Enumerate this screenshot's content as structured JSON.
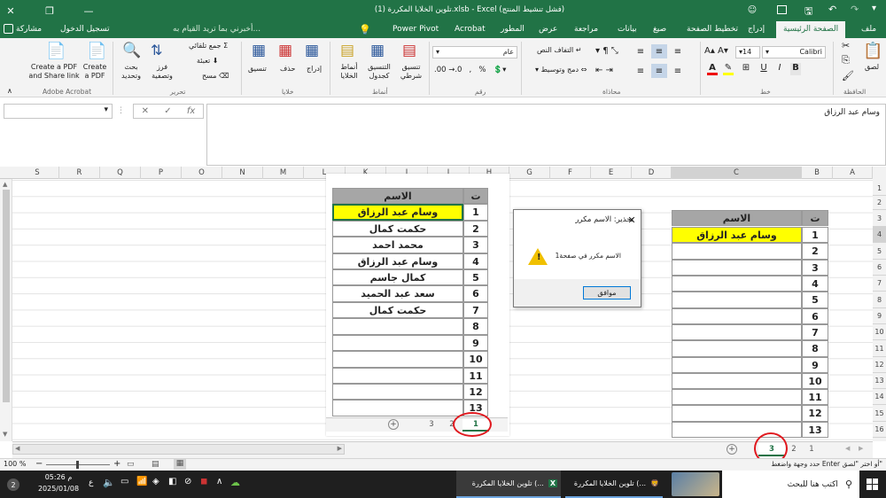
{
  "title_bar": {
    "title": "تلوين الخلايا المكررة (1).xlsb  -  Excel (فشل تنشيط المنتج)",
    "sign_in": "تسجيل الدخول",
    "share": "مشاركة"
  },
  "ribbon_tabs": {
    "file": "ملف",
    "home": "الصفحة الرئيسية",
    "insert": "إدراج",
    "page_layout": "تخطيط الصفحة",
    "formulas": "صيغ",
    "data": "بيانات",
    "review": "مراجعة",
    "view": "عرض",
    "developer": "المطور",
    "acrobat": "Acrobat",
    "power_pivot": "Power Pivot",
    "tell_me": "أخبرني بما تريد القيام به..."
  },
  "ribbon": {
    "paste": "لصق",
    "clipboard": "الحافظة",
    "font_name": "Calibri",
    "font_size": "14",
    "font_group": "خط",
    "wrap_text": "التفاف النص",
    "merge_center": "دمج وتوسيط",
    "alignment_group": "محاذاة",
    "number_format": "عام",
    "number_group": "رقم",
    "conditional_formatting": "تنسيق شرطي",
    "format_as_table": "التنسيق كجدول",
    "cell_styles": "أنماط الخلايا",
    "styles_group": "أنماط",
    "insert_cells": "إدراج",
    "delete_cells": "حذف",
    "format_cells": "تنسيق",
    "cells_group": "خلايا",
    "autosum": "جمع تلقائي",
    "fill": "تعبئة",
    "clear": "مسح",
    "sort_filter": "فرز وتصفية",
    "find_select": "بحث وتحديد",
    "editing_group": "تحرير",
    "create_pdf": "Create a PDF",
    "create_share": "Create a PDF and Share link",
    "acrobat_group": "Adobe Acrobat"
  },
  "formula_bar": {
    "content": "وسام عبد الرزاق",
    "fx": "fx"
  },
  "columns_right": [
    "A",
    "B",
    "C",
    "D",
    "E",
    "F",
    "G",
    "H",
    "I",
    "J",
    "K",
    "L",
    "M",
    "N",
    "O",
    "P",
    "Q",
    "R",
    "S"
  ],
  "rows": [
    "1",
    "2",
    "3",
    "4",
    "5",
    "6",
    "7",
    "8",
    "9",
    "10",
    "11",
    "12",
    "13",
    "14",
    "15",
    "16"
  ],
  "left_table": {
    "header_num": "ت",
    "header_name": "الاسم",
    "rows": [
      {
        "n": "1",
        "name": "وسام عبد الرزاق",
        "highlight": true
      },
      {
        "n": "2",
        "name": "حكمت كمال",
        "highlight": false
      },
      {
        "n": "3",
        "name": "محمد احمد",
        "highlight": false
      },
      {
        "n": "4",
        "name": "وسام عبد الرزاق",
        "highlight": false
      },
      {
        "n": "5",
        "name": "كمال جاسم",
        "highlight": false
      },
      {
        "n": "6",
        "name": "سعد عبد الحميد",
        "highlight": false
      },
      {
        "n": "7",
        "name": "حكمت كمال",
        "highlight": false
      },
      {
        "n": "8",
        "name": "",
        "highlight": false
      },
      {
        "n": "9",
        "name": "",
        "highlight": false
      },
      {
        "n": "10",
        "name": "",
        "highlight": false
      },
      {
        "n": "11",
        "name": "",
        "highlight": false
      },
      {
        "n": "12",
        "name": "",
        "highlight": false
      },
      {
        "n": "13",
        "name": "",
        "highlight": false
      }
    ],
    "sheet_tabs": [
      "1",
      "2",
      "3"
    ]
  },
  "right_table": {
    "header_num": "ت",
    "header_name": "الاسم",
    "rows": [
      {
        "n": "1",
        "name": "وسام عبد الرزاق",
        "highlight": true
      },
      {
        "n": "2",
        "name": "",
        "highlight": false
      },
      {
        "n": "3",
        "name": "",
        "highlight": false
      },
      {
        "n": "4",
        "name": "",
        "highlight": false
      },
      {
        "n": "5",
        "name": "",
        "highlight": false
      },
      {
        "n": "6",
        "name": "",
        "highlight": false
      },
      {
        "n": "7",
        "name": "",
        "highlight": false
      },
      {
        "n": "8",
        "name": "",
        "highlight": false
      },
      {
        "n": "9",
        "name": "",
        "highlight": false
      },
      {
        "n": "10",
        "name": "",
        "highlight": false
      },
      {
        "n": "11",
        "name": "",
        "highlight": false
      },
      {
        "n": "12",
        "name": "",
        "highlight": false
      },
      {
        "n": "13",
        "name": "",
        "highlight": false
      }
    ]
  },
  "dialog": {
    "title": "تحذير: الاسم مكرر",
    "message": "الاسم مكرر في صفحة1",
    "ok": "موافق"
  },
  "sheet_tabs_main": [
    "1",
    "2",
    "3"
  ],
  "status_bar": {
    "message": "حدد وجهة واضغط Enter أو اختر \"لصق\"",
    "zoom": "100 %"
  },
  "taskbar": {
    "search": "اكتب هنا للبحث",
    "app1": "تلوين الخلايا المكررة (...",
    "app2": "تلوين الخلايا المكررة (...",
    "time": "05:26 م",
    "date": "2025/01/08",
    "lang": "ع",
    "notif": "2"
  },
  "colors": {
    "excel_green": "#217346",
    "highlight": "#ffff00",
    "header_gray": "#a6a6a6",
    "annotation_red": "#e0191f"
  }
}
